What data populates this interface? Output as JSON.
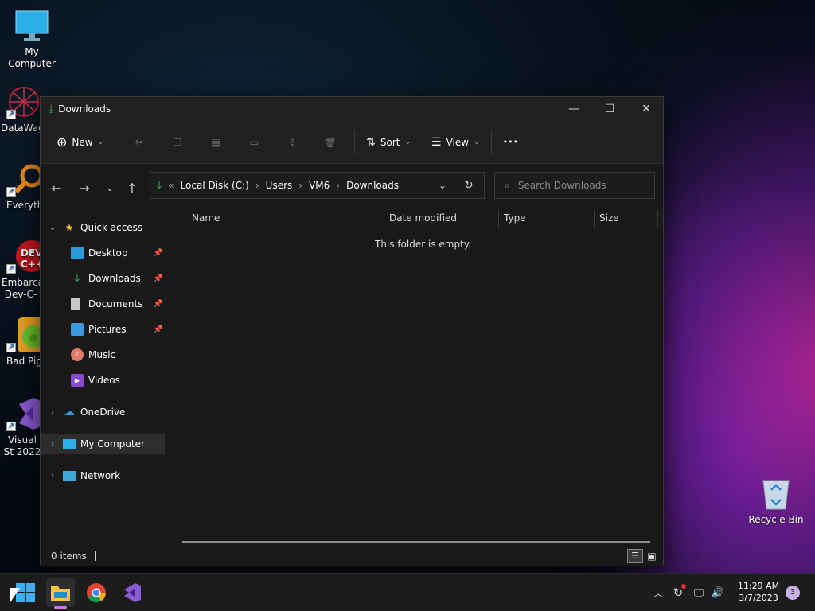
{
  "desktop": {
    "icons": [
      {
        "label": "My Computer"
      },
      {
        "label": "DataWag"
      },
      {
        "label": "Everyth"
      },
      {
        "label": "Embarca Dev-C-"
      },
      {
        "label": "Bad Pig"
      },
      {
        "label": "Visual St 2022"
      },
      {
        "label": "Recycle Bin"
      }
    ]
  },
  "window": {
    "title": "Downloads",
    "toolbar": {
      "new_label": "New",
      "sort_label": "Sort",
      "view_label": "View",
      "more_label": "•••"
    },
    "address": {
      "overflow": "«",
      "crumbs": [
        "Local Disk (C:)",
        "Users",
        "VM6",
        "Downloads"
      ]
    },
    "search": {
      "placeholder": "Search Downloads"
    },
    "sidebar": {
      "quick_access": "Quick access",
      "items": [
        {
          "label": "Desktop"
        },
        {
          "label": "Downloads"
        },
        {
          "label": "Documents"
        },
        {
          "label": "Pictures"
        },
        {
          "label": "Music"
        },
        {
          "label": "Videos"
        }
      ],
      "onedrive": "OneDrive",
      "my_computer": "My Computer",
      "network": "Network"
    },
    "columns": [
      "Name",
      "Date modified",
      "Type",
      "Size"
    ],
    "empty_message": "This folder is empty.",
    "status": {
      "count": "0 items"
    }
  },
  "taskbar": {
    "time": "11:29 AM",
    "date": "3/7/2023",
    "notification_count": "3"
  },
  "colors": {
    "accent": "#2aa8e0",
    "download_green": "#3fbf6f",
    "folder_yellow": "#f4c542"
  }
}
